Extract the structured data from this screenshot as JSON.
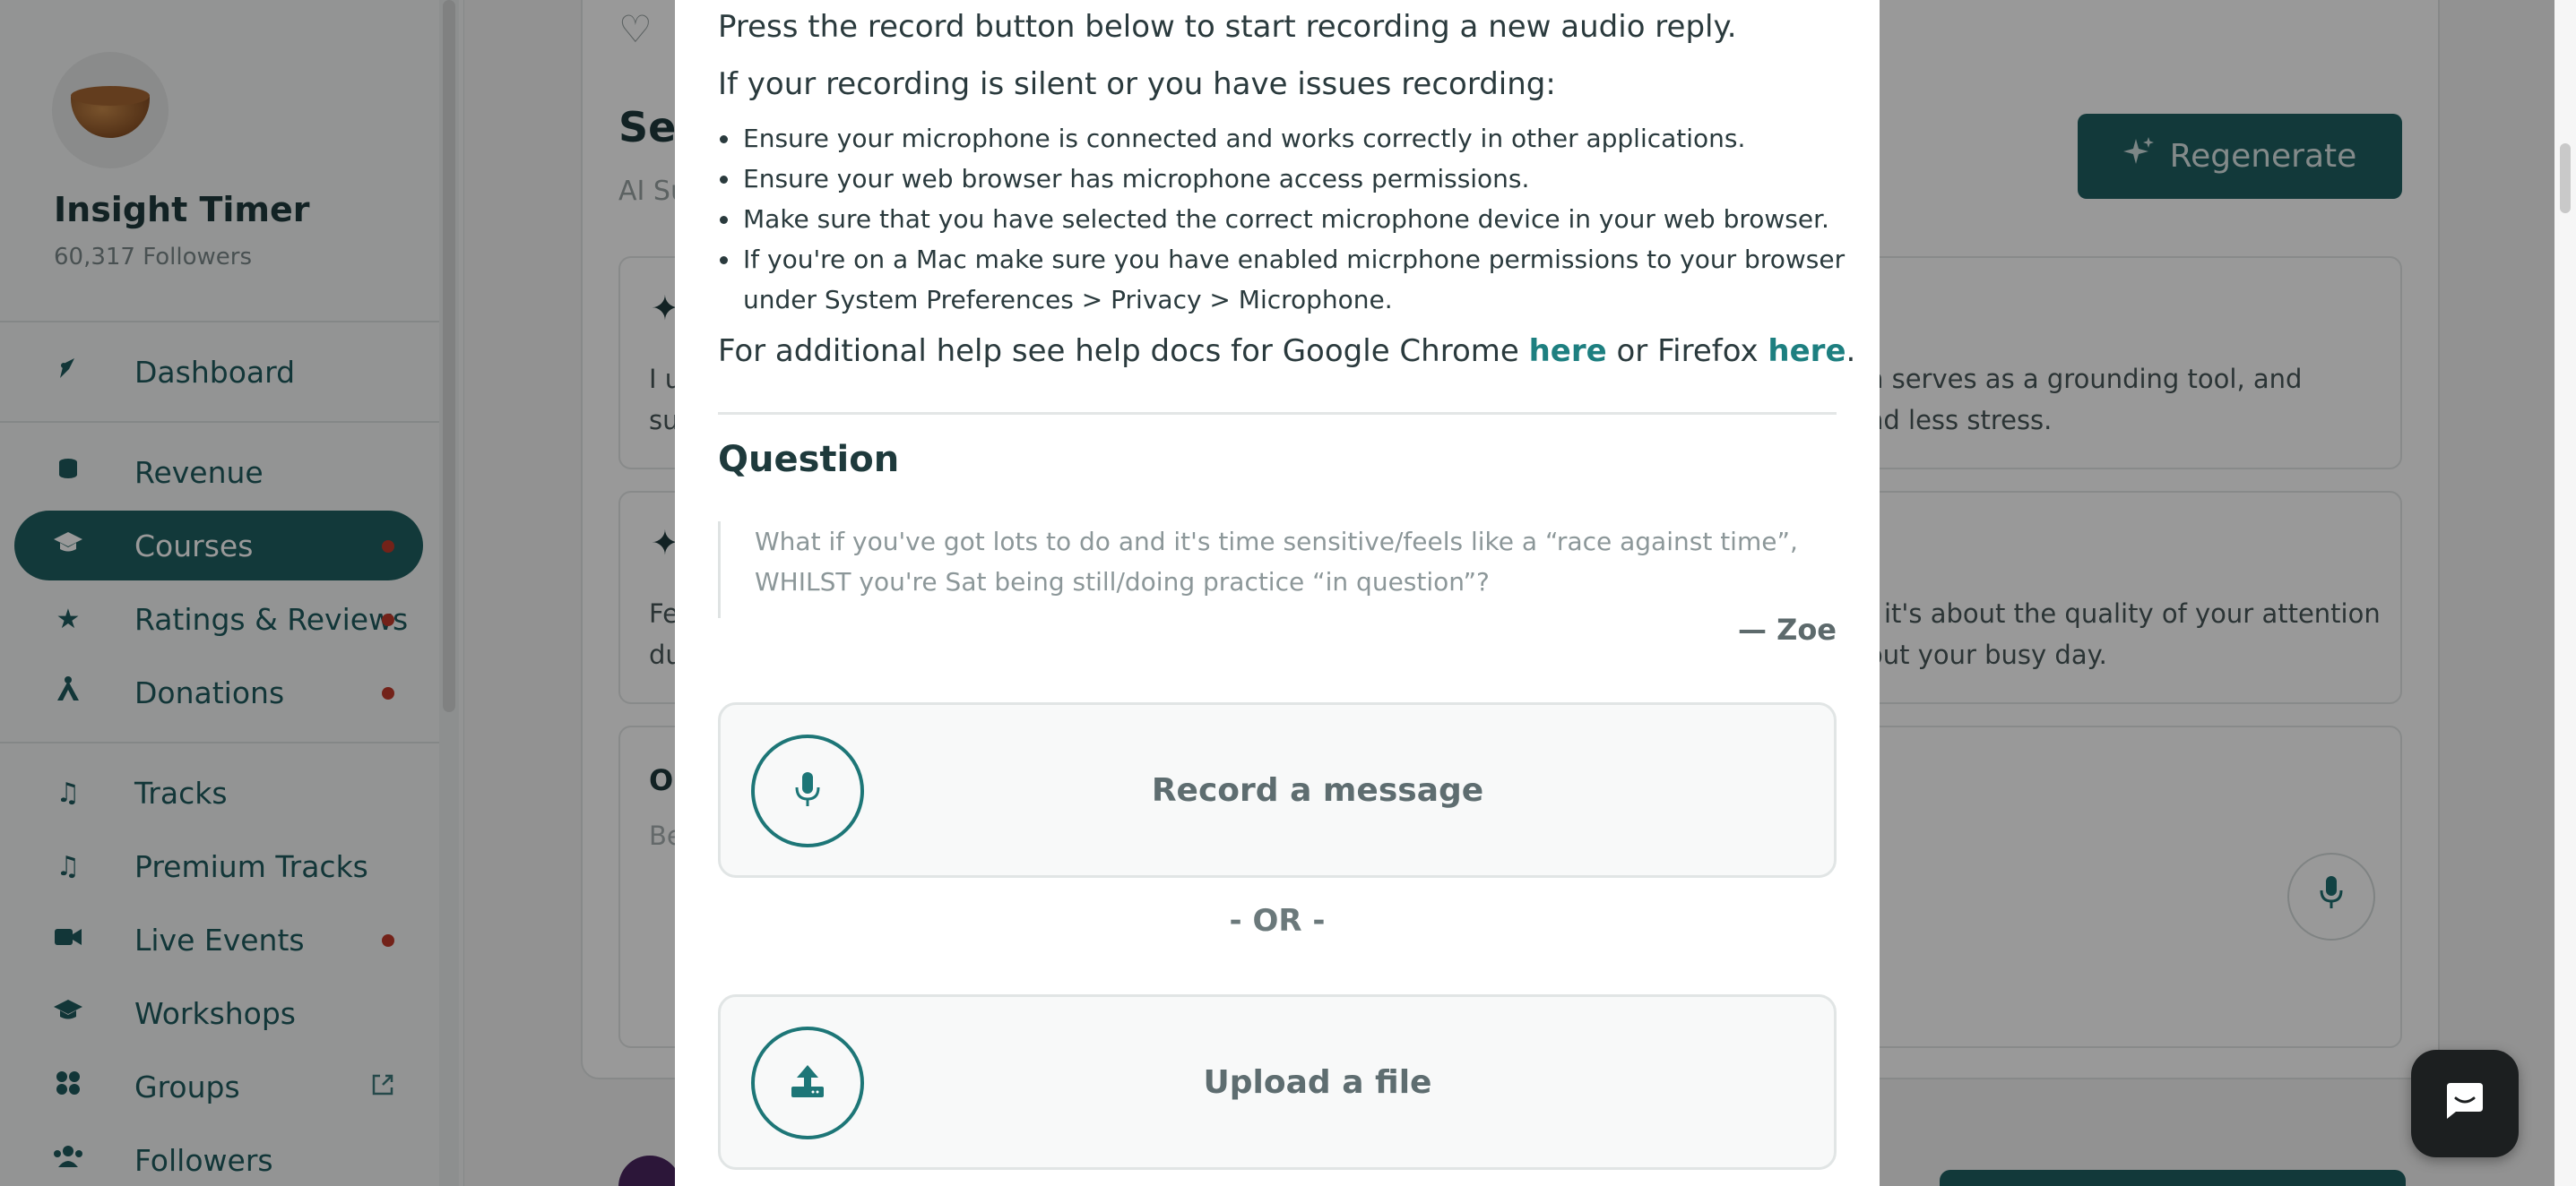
{
  "sidebar": {
    "brand": {
      "name": "Insight Timer",
      "followers": "60,317 Followers"
    },
    "nav": [
      {
        "label": "Dashboard",
        "icon": "dashboard-icon"
      },
      {
        "label": "Revenue",
        "icon": "coins-icon"
      },
      {
        "label": "Courses",
        "icon": "graduation-cap-icon",
        "active": true,
        "badge": true
      },
      {
        "label": "Ratings & Reviews",
        "icon": "star-icon",
        "badge": true
      },
      {
        "label": "Donations",
        "icon": "donation-icon",
        "badge": true
      },
      {
        "label": "Tracks",
        "icon": "music-note-icon"
      },
      {
        "label": "Premium Tracks",
        "icon": "music-note-icon"
      },
      {
        "label": "Live Events",
        "icon": "video-camera-icon",
        "badge": true
      },
      {
        "label": "Workshops",
        "icon": "graduation-cap-icon"
      },
      {
        "label": "Groups",
        "icon": "groups-icon",
        "external": true
      },
      {
        "label": "Followers",
        "icon": "users-icon"
      }
    ]
  },
  "background": {
    "title_fragment": "Sel",
    "subtitle_fragment": "AI Su",
    "regenerate_label": "Regenerate",
    "box1": {
      "left_line1": "I u",
      "left_line2": "su",
      "right_line1": "n serves as a grounding tool, and",
      "right_line2": "nd less stress."
    },
    "box2": {
      "left_line1": "Fe",
      "left_line2": "du",
      "right_line1": "; it's about the quality of your attention",
      "right_line2": "out your busy day."
    },
    "box3": {
      "heading_fragment": "O",
      "placeholder_fragment": "Be"
    }
  },
  "modal": {
    "intro": "Press the record button below to start recording a new audio reply.",
    "issues_heading": "If your recording is silent or you have issues recording:",
    "tips": [
      "Ensure your microphone is connected and works correctly in other applications.",
      "Ensure your web browser has microphone access permissions.",
      "Make sure that you have selected the correct microphone device in your web browser.",
      "If you're on a Mac make sure you have enabled micrphone permissions to your browser under System Preferences > Privacy > Microphone."
    ],
    "help": {
      "before": "For additional help see help docs for Google Chrome ",
      "link1": "here",
      "middle": " or Firefox ",
      "link2": "here",
      "after": "."
    },
    "question_heading": "Question",
    "question_text": "What if you've got lots to do and it's time sensitive/feels like a “race against time”, WHILST you're Sat being still/doing practice “in question”?",
    "question_author": "— Zoe",
    "record_label": "Record a message",
    "or_label": "- OR -",
    "upload_label": "Upload a file"
  },
  "colors": {
    "accent": "#1f5f61",
    "link": "#1d7f80",
    "badge": "#c0392b"
  }
}
